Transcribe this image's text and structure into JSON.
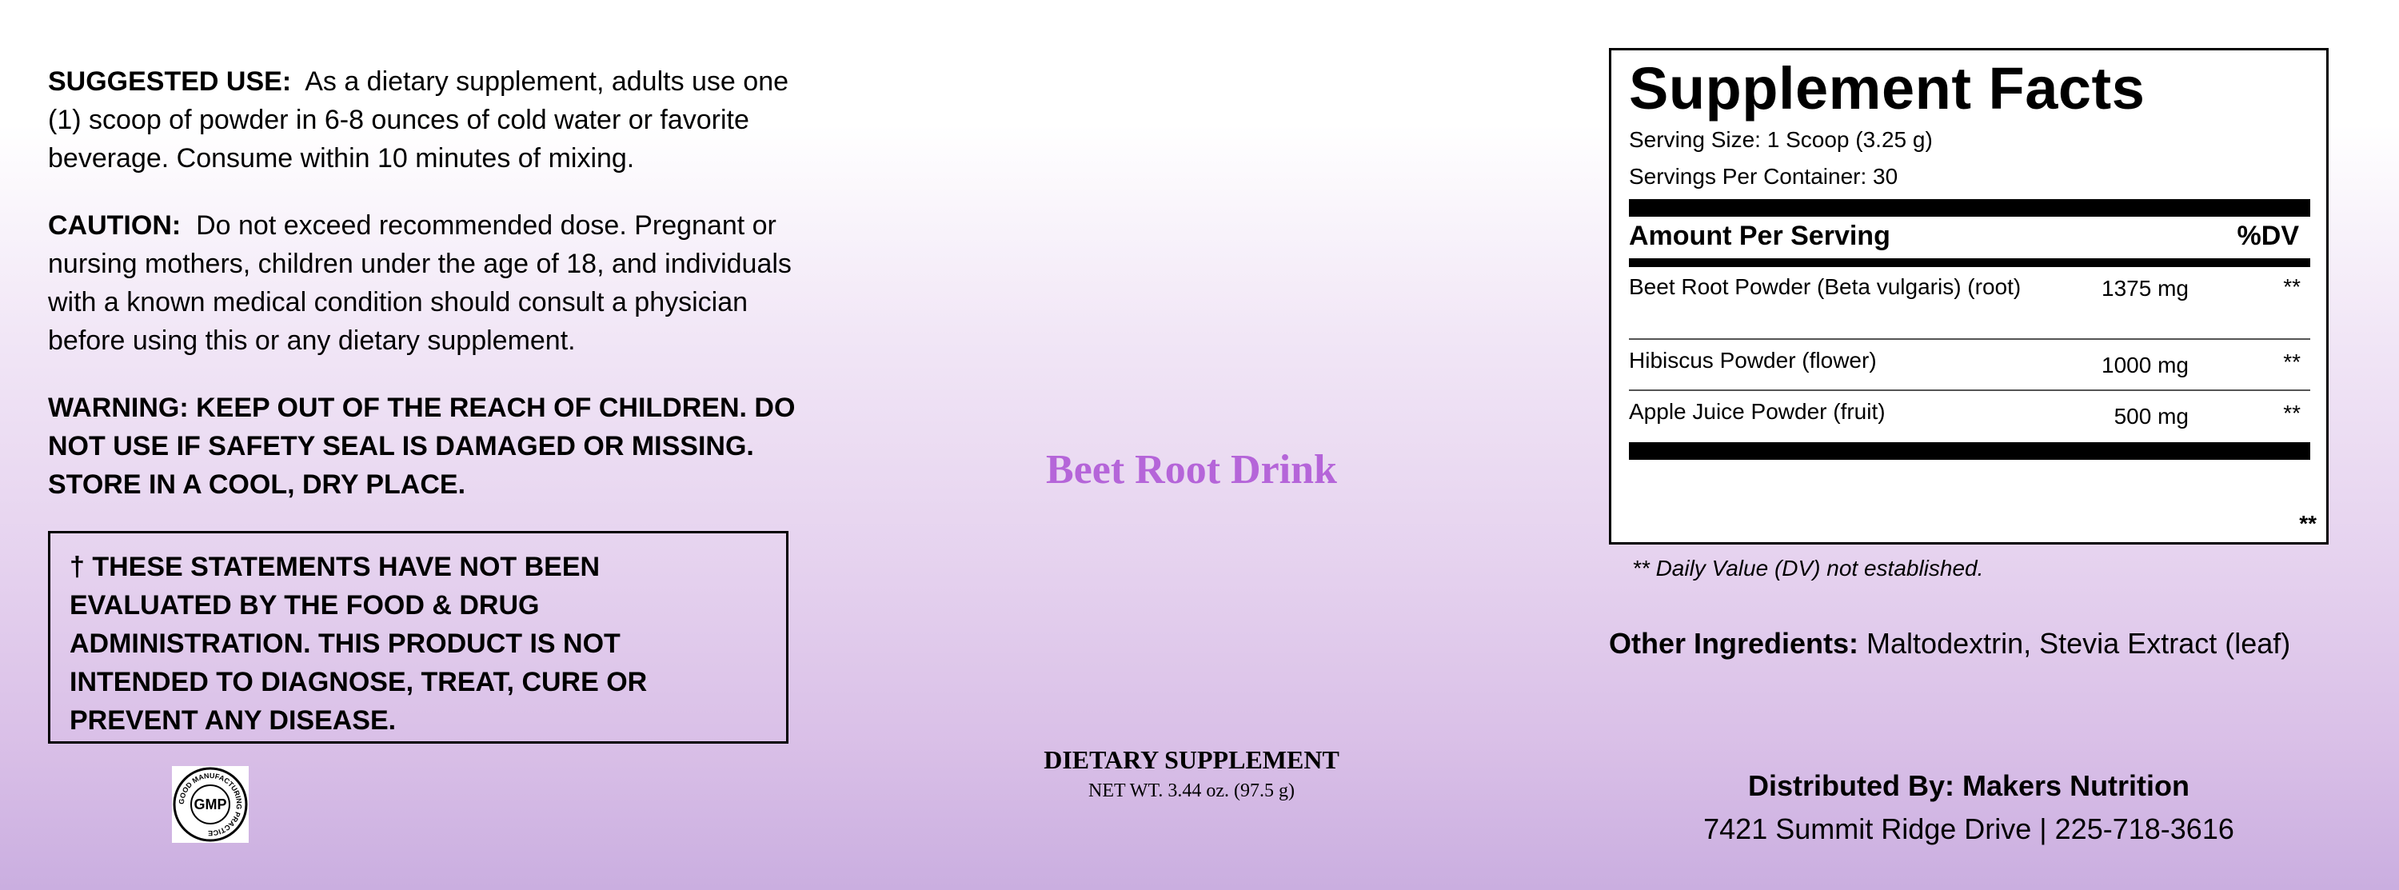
{
  "left": {
    "suggested_use_label": "SUGGESTED USE:",
    "suggested_use_text": "As a dietary supplement, adults use one (1) scoop of powder in 6-8 ounces of cold water or favorite beverage. Consume within 10 minutes of mixing.",
    "caution_label": "CAUTION:",
    "caution_text": "Do not exceed recommended dose. Pregnant or nursing mothers, children under the age of 18, and individuals with a known medical condition should consult a physician before using this or any dietary supplement.",
    "warning_text": "WARNING: KEEP OUT OF THE REACH OF CHILDREN. DO NOT USE IF SAFETY SEAL IS DAMAGED OR MISSING. STORE IN A COOL, DRY PLACE.",
    "fda_statement": "† THESE STATEMENTS HAVE NOT BEEN EVALUATED BY THE FOOD & DRUG ADMINISTRATION. THIS PRODUCT IS NOT INTENDED TO DIAGNOSE, TREAT, CURE OR PREVENT ANY DISEASE.",
    "gmp_seal": {
      "center_text": "GMP",
      "ring_text": "GOOD MANUFACTURING PRACTICE"
    }
  },
  "center": {
    "product_name": "Beet Root Drink",
    "product_color": "#b565d9",
    "dietary_label": "DIETARY SUPPLEMENT",
    "net_weight": "NET WT. 3.44 oz. (97.5 g)"
  },
  "facts": {
    "title": "Supplement Facts",
    "serving_size": "Serving Size: 1 Scoop (3.25 g)",
    "servings_per_container": "Servings Per Container: 30",
    "amount_header": "Amount Per Serving",
    "dv_header": "%DV",
    "ingredients": [
      {
        "name": "Beet Root Powder (Beta vulgaris) (root)",
        "amount": "1375 mg",
        "dv": "**"
      },
      {
        "name": "Hibiscus Powder (flower)",
        "amount": "1000 mg",
        "dv": "**"
      },
      {
        "name": "Apple Juice Powder (fruit)",
        "amount": "500 mg",
        "dv": "**"
      }
    ],
    "footer_stars": "**",
    "footnote": "** Daily Value (DV) not established."
  },
  "other_ingredients": {
    "label": "Other Ingredients:",
    "text": "Maltodextrin, Stevia Extract (leaf)"
  },
  "distributor": {
    "line": "Distributed By: Makers Nutrition",
    "address": "7421 Summit Ridge Drive | 225-718-3616"
  }
}
